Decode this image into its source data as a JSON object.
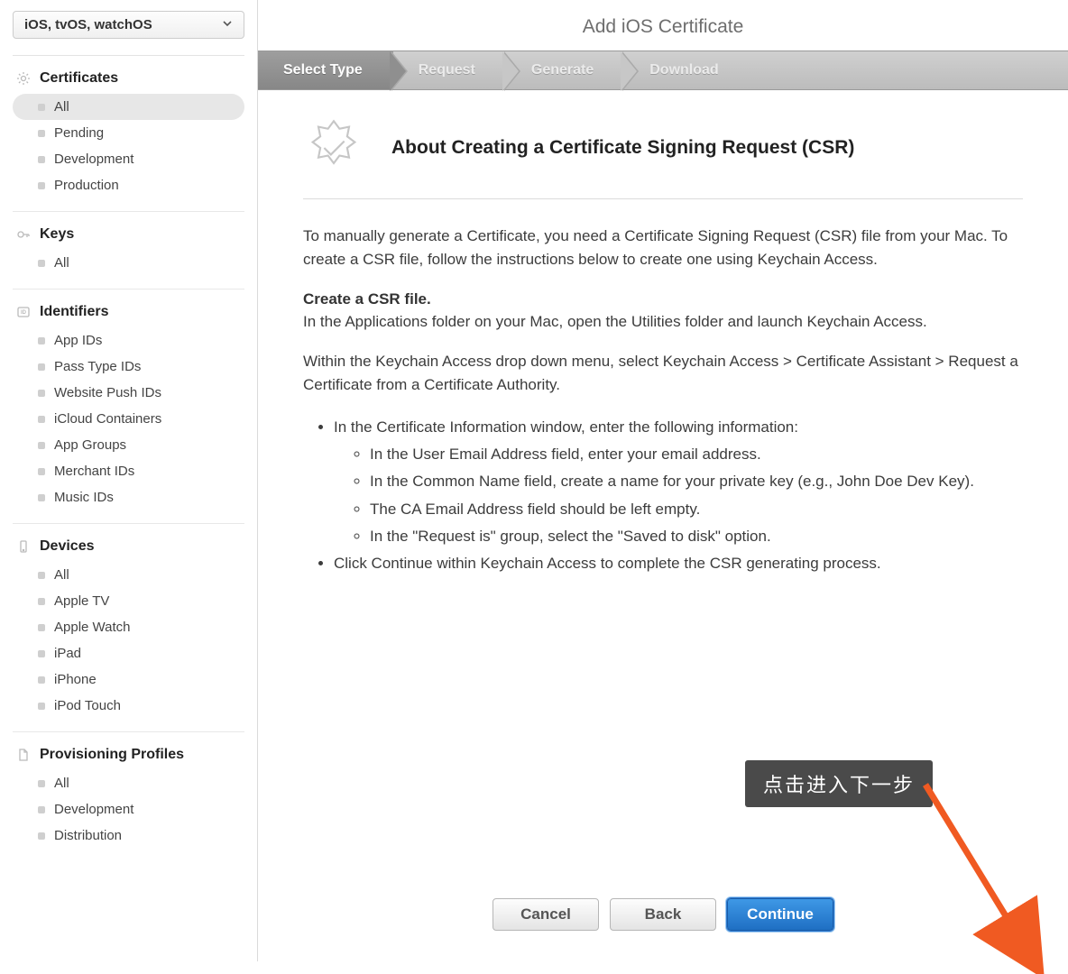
{
  "platformSelector": {
    "label": "iOS, tvOS, watchOS"
  },
  "sidebar": {
    "sections": [
      {
        "title": "Certificates",
        "icon": "gear",
        "items": [
          {
            "label": "All",
            "selected": true
          },
          {
            "label": "Pending"
          },
          {
            "label": "Development"
          },
          {
            "label": "Production"
          }
        ]
      },
      {
        "title": "Keys",
        "icon": "key",
        "items": [
          {
            "label": "All"
          }
        ]
      },
      {
        "title": "Identifiers",
        "icon": "id",
        "items": [
          {
            "label": "App IDs"
          },
          {
            "label": "Pass Type IDs"
          },
          {
            "label": "Website Push IDs"
          },
          {
            "label": "iCloud Containers"
          },
          {
            "label": "App Groups"
          },
          {
            "label": "Merchant IDs"
          },
          {
            "label": "Music IDs"
          }
        ]
      },
      {
        "title": "Devices",
        "icon": "device",
        "items": [
          {
            "label": "All"
          },
          {
            "label": "Apple TV"
          },
          {
            "label": "Apple Watch"
          },
          {
            "label": "iPad"
          },
          {
            "label": "iPhone"
          },
          {
            "label": "iPod Touch"
          }
        ]
      },
      {
        "title": "Provisioning Profiles",
        "icon": "file",
        "items": [
          {
            "label": "All"
          },
          {
            "label": "Development"
          },
          {
            "label": "Distribution"
          }
        ]
      }
    ]
  },
  "page": {
    "title": "Add iOS Certificate",
    "steps": [
      "Select Type",
      "Request",
      "Generate",
      "Download"
    ],
    "activeStep": 0,
    "heroTitle": "About Creating a Certificate Signing Request (CSR)",
    "intro": "To manually generate a Certificate, you need a Certificate Signing Request (CSR) file from your Mac. To create a CSR file, follow the instructions below to create one using Keychain Access.",
    "subhead": "Create a CSR file.",
    "para2": "In the Applications folder on your Mac, open the Utilities folder and launch Keychain Access.",
    "para3": "Within the Keychain Access drop down menu, select Keychain Access > Certificate Assistant > Request a Certificate from a Certificate Authority.",
    "bullets": [
      "In the Certificate Information window, enter the following information:",
      "Click Continue within Keychain Access to complete the CSR generating process."
    ],
    "nestedBullets": [
      "In the User Email Address field, enter your email address.",
      "In the Common Name field, create a name for your private key (e.g., John Doe Dev Key).",
      "The CA Email Address field should be left empty.",
      "In the \"Request is\" group, select the \"Saved to disk\" option."
    ],
    "buttons": {
      "cancel": "Cancel",
      "back": "Back",
      "continue": "Continue"
    }
  },
  "annotation": {
    "text": "点击进入下一步"
  }
}
